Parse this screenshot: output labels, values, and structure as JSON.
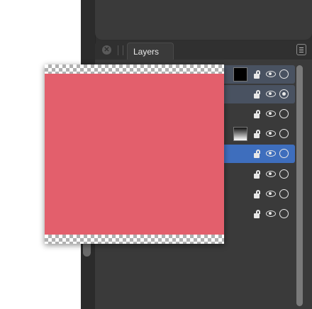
{
  "panel": {
    "tab_label": "Layers",
    "close_icon": "close-icon",
    "grip_icon": "grip-icon",
    "menu_icon": "panel-menu-icon"
  },
  "layers": [
    {
      "thumbnail": "black",
      "locked": false,
      "visible": true,
      "active": false,
      "state": "highlighted"
    },
    {
      "thumbnail": null,
      "locked": false,
      "visible": true,
      "active": true,
      "state": "highlighted"
    },
    {
      "thumbnail": null,
      "locked": false,
      "visible": true,
      "active": false,
      "state": "normal"
    },
    {
      "thumbnail": "gradient",
      "locked": false,
      "visible": true,
      "active": false,
      "state": "normal"
    },
    {
      "thumbnail": null,
      "locked": false,
      "visible": true,
      "active": false,
      "state": "selected"
    },
    {
      "thumbnail": null,
      "locked": false,
      "visible": true,
      "active": false,
      "state": "normal"
    },
    {
      "thumbnail": null,
      "locked": false,
      "visible": true,
      "active": false,
      "state": "normal"
    },
    {
      "thumbnail": null,
      "locked": false,
      "visible": true,
      "active": false,
      "state": "normal"
    }
  ],
  "preview": {
    "fill_color": "#e35f6c",
    "background": "transparency-checkerboard"
  },
  "colors": {
    "panel_bg": "#3a3a3a",
    "selected_row": "#3e6ebd",
    "highlighted_row": "#495261"
  }
}
